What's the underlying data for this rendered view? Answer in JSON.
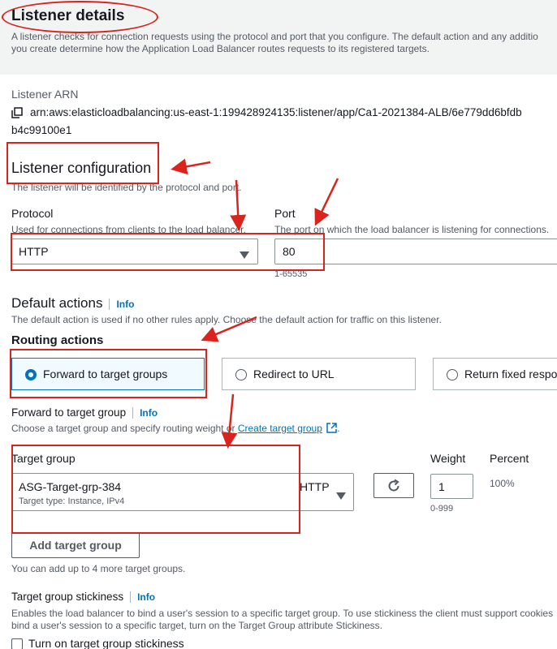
{
  "listener_details": {
    "title": "Listener details",
    "desc_line1": "A listener checks for connection requests using the protocol and port that you configure. The default action and any additio",
    "desc_line2": "you create determine how the Application Load Balancer routes requests to its registered targets."
  },
  "arn": {
    "label": "Listener ARN",
    "value_line1": "arn:aws:elasticloadbalancing:us-east-1:199428924135:listener/app/Ca1-2021384-ALB/6e779dd6bfdb",
    "value_line2": "b4c99100e1",
    "copy_icon": "copy-icon"
  },
  "listener_config": {
    "title": "Listener configuration",
    "desc": "The listener will be identified by the protocol and port.",
    "protocol": {
      "label": "Protocol",
      "desc": "Used for connections from clients to the load balancer.",
      "value": "HTTP"
    },
    "port": {
      "label": "Port",
      "desc": "The port on which the load balancer is listening for connections.",
      "value": "80",
      "constraint": "1-65535"
    }
  },
  "default_actions": {
    "title": "Default actions",
    "info": "Info",
    "desc": "The default action is used if no other rules apply. Choose the default action for traffic on this listener.",
    "routing_title": "Routing actions",
    "options": [
      {
        "label": "Forward to target groups",
        "selected": true
      },
      {
        "label": "Redirect to URL",
        "selected": false
      },
      {
        "label": "Return fixed respo",
        "selected": false
      }
    ]
  },
  "forward": {
    "title": "Forward to target group",
    "info": "Info",
    "desc_prefix": "Choose a target group and specify routing weight or ",
    "create_link": "Create target group",
    "desc_suffix": ".",
    "columns": {
      "target_group": "Target group",
      "weight": "Weight",
      "percent": "Percent"
    },
    "target_group_value": "ASG-Target-grp-384",
    "target_group_sub": "Target type: Instance, IPv4",
    "target_group_protocol": "HTTP",
    "weight_value": "1",
    "weight_constraint": "0-999",
    "percent_value": "100%",
    "add_button": "Add target group",
    "add_note": "You can add up to 4 more target groups."
  },
  "stickiness": {
    "title": "Target group stickiness",
    "info": "Info",
    "desc_line1": "Enables the load balancer to bind a user's session to a specific target group. To use stickiness the client must support cookies",
    "desc_line2": "bind a user's session to a specific target, turn on the Target Group attribute Stickiness.",
    "checkbox_label": "Turn on target group stickiness"
  },
  "colors": {
    "annotation": "#d9231c",
    "link": "#0073bb",
    "selected_bg": "#f1faff"
  }
}
